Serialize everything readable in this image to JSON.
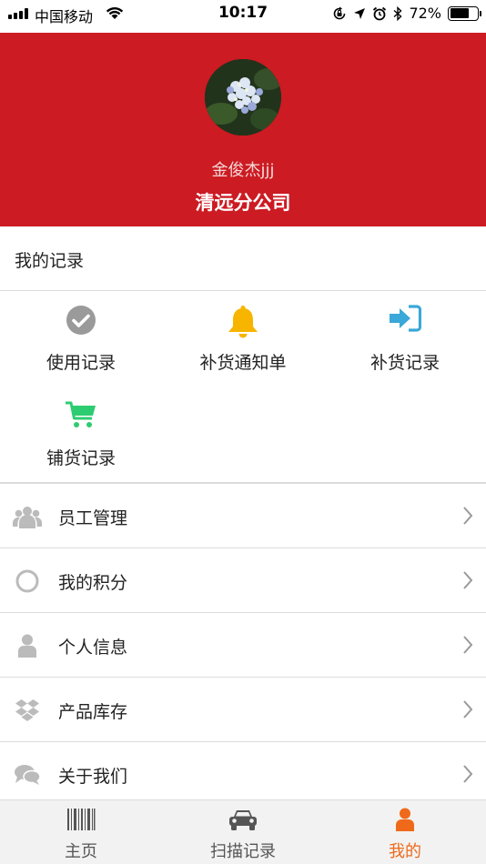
{
  "status_bar": {
    "carrier": "中国移动",
    "time": "10:17",
    "battery_percent": "72%",
    "battery_level": 0.72,
    "icons": [
      "signal-icon",
      "wifi-icon",
      "orientation-lock-icon",
      "location-icon",
      "alarm-icon",
      "bluetooth-icon",
      "battery-icon"
    ]
  },
  "profile": {
    "avatar": "avatar-flower-photo",
    "user_name": "金俊杰jjj",
    "company": "清远分公司",
    "header_color": "#cc1b22"
  },
  "records": {
    "title": "我的记录",
    "items": [
      {
        "label": "使用记录",
        "icon": "check-circle-icon",
        "color": "#9a9a9a"
      },
      {
        "label": "补货通知单",
        "icon": "bell-icon",
        "color": "#f7b500"
      },
      {
        "label": "补货记录",
        "icon": "sign-in-icon",
        "color": "#3aa8d8"
      },
      {
        "label": "铺货记录",
        "icon": "cart-icon",
        "color": "#2ecc71"
      }
    ]
  },
  "menu": [
    {
      "label": "员工管理",
      "icon": "users-icon"
    },
    {
      "label": "我的积分",
      "icon": "circle-icon"
    },
    {
      "label": "个人信息",
      "icon": "user-icon"
    },
    {
      "label": "产品库存",
      "icon": "dropbox-icon"
    },
    {
      "label": "关于我们",
      "icon": "chat-icon"
    }
  ],
  "tab_bar": {
    "active_color": "#ee6a1a",
    "tabs": [
      {
        "label": "主页",
        "icon": "barcode-icon",
        "active": false
      },
      {
        "label": "扫描记录",
        "icon": "car-icon",
        "active": false
      },
      {
        "label": "我的",
        "icon": "user-icon",
        "active": true
      }
    ]
  }
}
